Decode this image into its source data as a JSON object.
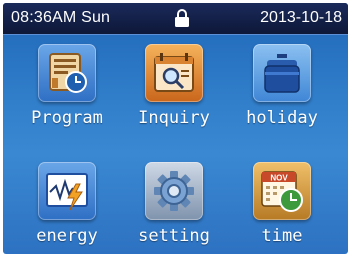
{
  "status_bar": {
    "time": "08:36AM Sun",
    "date": "2013-10-18",
    "lock_icon": "lock-icon"
  },
  "menu": {
    "items": [
      {
        "label": "Program",
        "icon": "program-icon"
      },
      {
        "label": "Inquiry",
        "icon": "inquiry-icon"
      },
      {
        "label": "holiday",
        "icon": "holiday-suitcase-icon"
      },
      {
        "label": "energy",
        "icon": "energy-graph-icon"
      },
      {
        "label": "setting",
        "icon": "gear-icon"
      },
      {
        "label": "time",
        "icon": "calendar-clock-icon"
      }
    ],
    "calendar_badge": "NOV"
  },
  "colors": {
    "background": "#2f7cc9",
    "status_bar": "#0d1738",
    "text": "#ffffff"
  }
}
